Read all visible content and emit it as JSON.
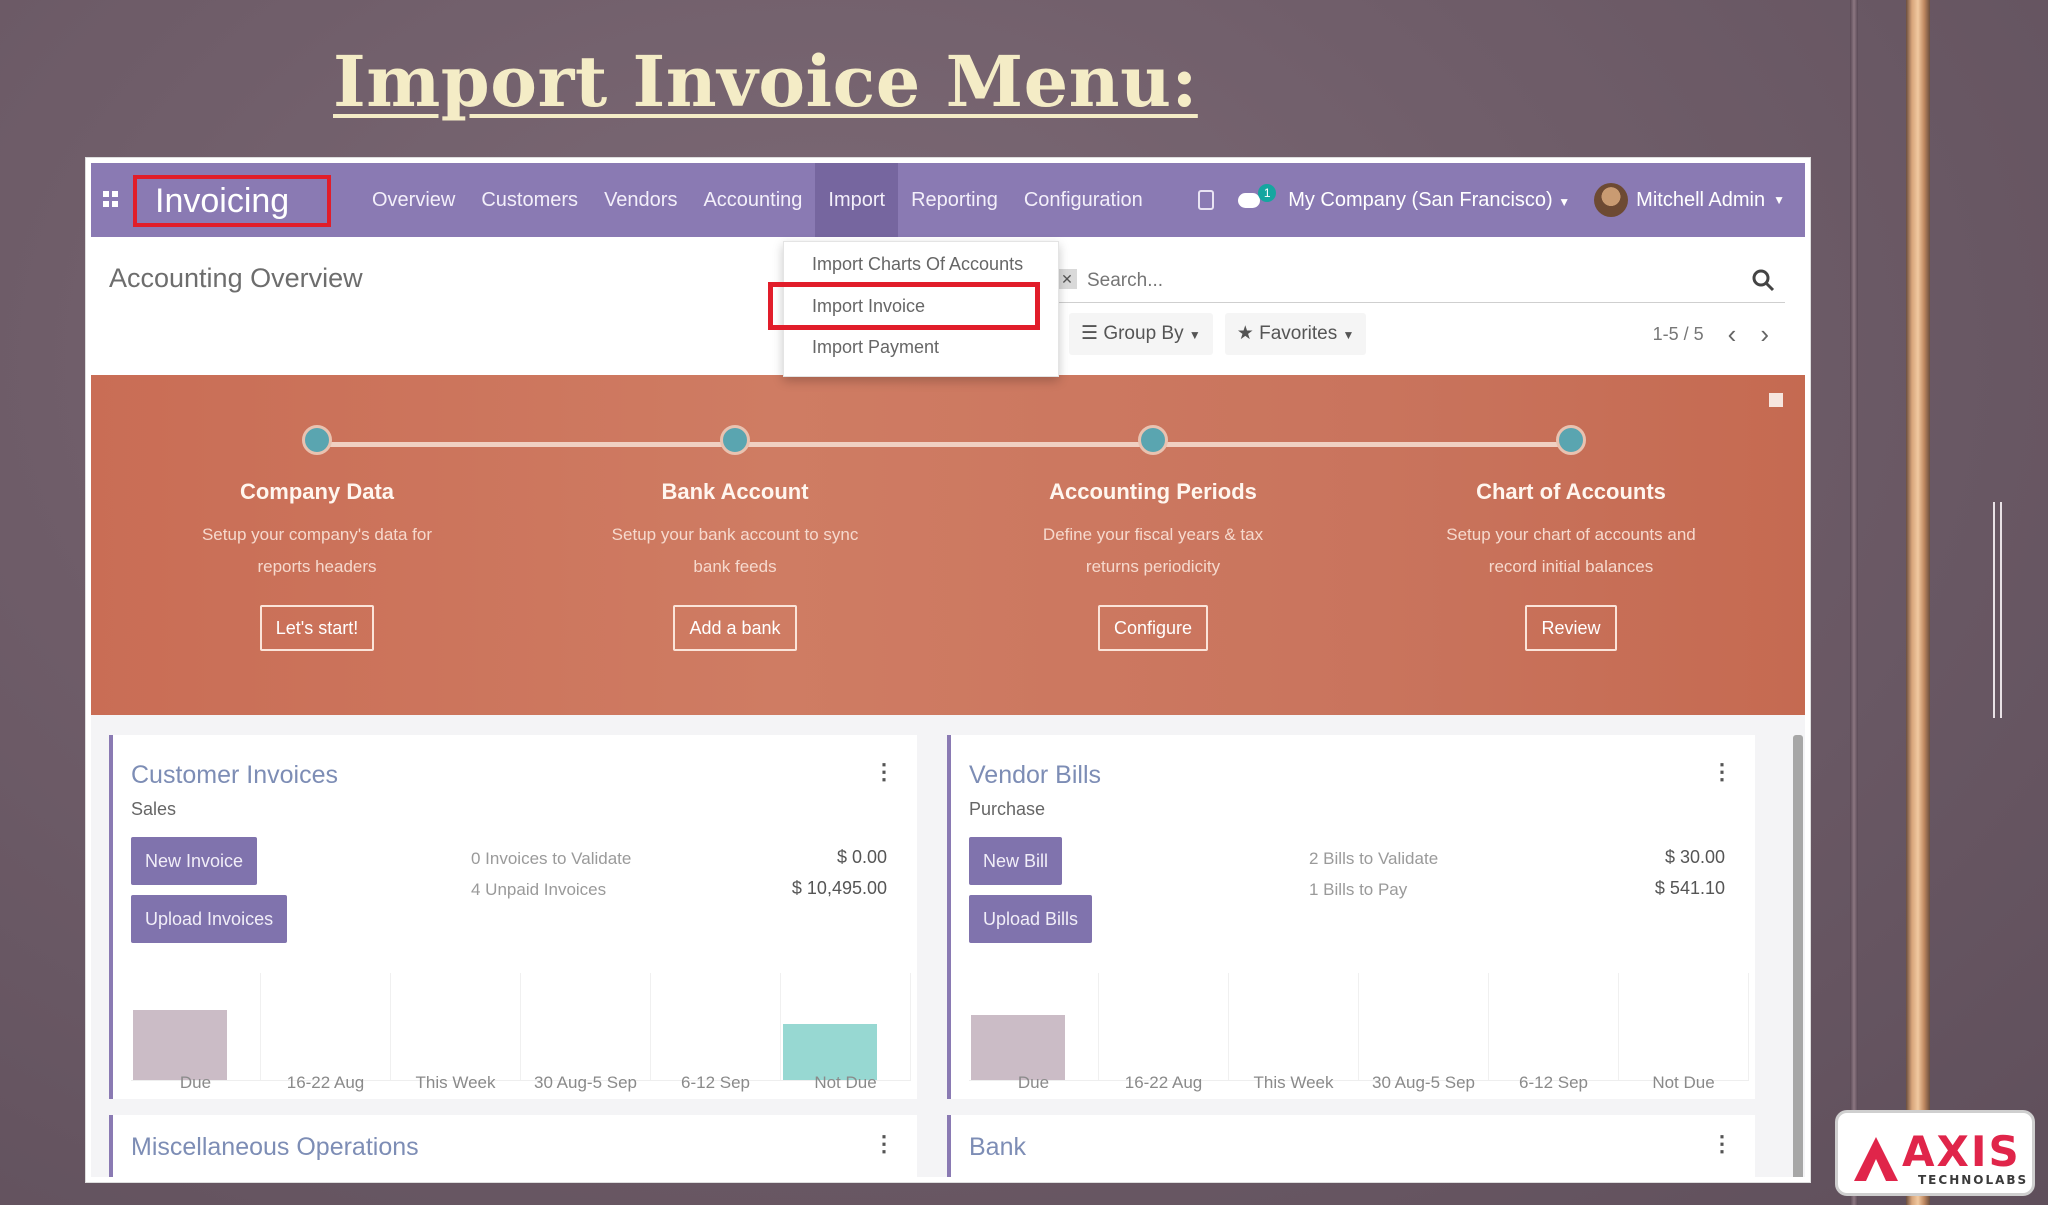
{
  "slide_title": "Import Invoice Menu:",
  "logo": {
    "name": "AXIS",
    "sub": "TECHNOLABS",
    "color": "#e0254a"
  },
  "app": {
    "brand": "Invoicing",
    "menu": [
      "Overview",
      "Customers",
      "Vendors",
      "Accounting",
      "Import",
      "Reporting",
      "Configuration"
    ],
    "active_menu": "Import",
    "chat_count": "1",
    "company": "My Company (San Francisco)",
    "user": "Mitchell Admin",
    "accent": "#8a7ab3",
    "highlight": "#e11d2a"
  },
  "dropdown": {
    "items": [
      "Import Charts Of Accounts",
      "Import Invoice",
      "Import Payment"
    ],
    "highlighted": "Import Invoice"
  },
  "control": {
    "title": "Accounting Overview",
    "search_placeholder": "Search...",
    "group_by": "Group By",
    "favorites": "Favorites",
    "pager": "1-5 / 5"
  },
  "onboarding": {
    "steps": [
      {
        "title": "Company Data",
        "desc1": "Setup your company's data for",
        "desc2": "reports headers",
        "button": "Let's start!"
      },
      {
        "title": "Bank Account",
        "desc1": "Setup your bank account to sync",
        "desc2": "bank feeds",
        "button": "Add a bank"
      },
      {
        "title": "Accounting Periods",
        "desc1": "Define your fiscal years & tax",
        "desc2": "returns periodicity",
        "button": "Configure"
      },
      {
        "title": "Chart of Accounts",
        "desc1": "Setup your chart of accounts and",
        "desc2": "record initial balances",
        "button": "Review"
      }
    ]
  },
  "cards": {
    "customer": {
      "title": "Customer Invoices",
      "sub": "Sales",
      "btn1": "New Invoice",
      "btn2": "Upload Invoices",
      "stat1_label": "0 Invoices to Validate",
      "stat1_val": "$ 0.00",
      "stat2_label": "4 Unpaid Invoices",
      "stat2_val": "$ 10,495.00"
    },
    "vendor": {
      "title": "Vendor Bills",
      "sub": "Purchase",
      "btn1": "New Bill",
      "btn2": "Upload Bills",
      "stat1_label": "2 Bills to Validate",
      "stat1_val": "$ 30.00",
      "stat2_label": "1 Bills to Pay",
      "stat2_val": "$ 541.10"
    },
    "misc": {
      "title": "Miscellaneous Operations"
    },
    "bank": {
      "title": "Bank"
    }
  },
  "chart_data": [
    {
      "type": "bar",
      "categories": [
        "Due",
        "16-22 Aug",
        "This Week",
        "30 Aug-5 Sep",
        "6-12 Sep",
        "Not Due"
      ],
      "values": [
        0.78,
        0,
        0,
        0,
        0,
        0.62
      ],
      "colors": [
        "#cbbcc6",
        "#cbbcc6",
        "#cbbcc6",
        "#cbbcc6",
        "#cbbcc6",
        "#97d8d2"
      ]
    },
    {
      "type": "bar",
      "categories": [
        "Due",
        "16-22 Aug",
        "This Week",
        "30 Aug-5 Sep",
        "6-12 Sep",
        "Not Due"
      ],
      "values": [
        0.72,
        0,
        0,
        0,
        0,
        0
      ],
      "colors": [
        "#cbbcc6",
        "#cbbcc6",
        "#cbbcc6",
        "#cbbcc6",
        "#cbbcc6",
        "#cbbcc6"
      ]
    }
  ]
}
